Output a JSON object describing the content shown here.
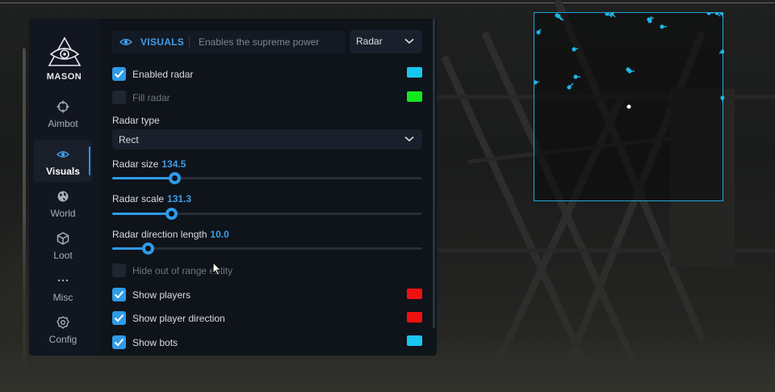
{
  "brand": {
    "name": "MASON"
  },
  "sidebar": {
    "items": [
      {
        "label": "Aimbot",
        "icon": "crosshair-icon",
        "active": false
      },
      {
        "label": "Visuals",
        "icon": "eye-icon",
        "active": true
      },
      {
        "label": "World",
        "icon": "globe-icon",
        "active": false
      },
      {
        "label": "Loot",
        "icon": "cube-icon",
        "active": false
      },
      {
        "label": "Misc",
        "icon": "more-icon",
        "active": false
      },
      {
        "label": "Config",
        "icon": "gear-icon",
        "active": false
      }
    ]
  },
  "header": {
    "title": "VISUALS",
    "subtitle": "Enables the supreme power",
    "tab_select": "Radar"
  },
  "options": {
    "enabled_radar": {
      "label": "Enabled radar",
      "checked": true,
      "color": "#18c6f0"
    },
    "fill_radar": {
      "label": "Fill radar",
      "checked": false,
      "color": "#12e81c"
    },
    "radar_type": {
      "label": "Radar type",
      "value": "Rect"
    },
    "radar_size": {
      "label": "Radar size",
      "value": "134.5",
      "fraction": 0.2
    },
    "radar_scale": {
      "label": "Radar scale",
      "value": "131.3",
      "fraction": 0.19
    },
    "radar_direction_length": {
      "label": "Radar direction length",
      "value": "10.0",
      "fraction": 0.115
    },
    "hide_out_of_range": {
      "label": "Hide out of range entity",
      "checked": false
    },
    "show_players": {
      "label": "Show players",
      "checked": true,
      "color": "#ee1111"
    },
    "show_player_direction": {
      "label": "Show player direction",
      "checked": true,
      "color": "#ee1111"
    },
    "show_bots": {
      "label": "Show bots",
      "checked": true,
      "color": "#18c6f0"
    }
  },
  "colors": {
    "accent": "#2f9be8",
    "radar_border": "#1ea7d8",
    "radar_dot": "#22b4e6"
  }
}
